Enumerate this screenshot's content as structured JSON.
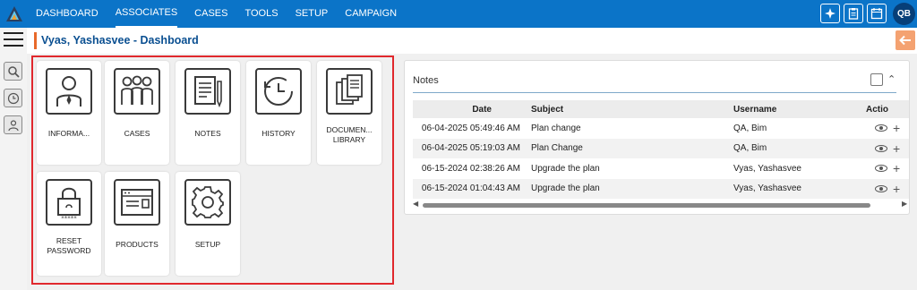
{
  "nav": {
    "items": [
      "DASHBOARD",
      "ASSOCIATES",
      "CASES",
      "TOOLS",
      "SETUP",
      "CAMPAIGN"
    ],
    "active": "ASSOCIATES"
  },
  "user": {
    "initials": "QB"
  },
  "page": {
    "title": "Vyas, Yashasvee - Dashboard"
  },
  "tiles": [
    {
      "label": "INFORMA...",
      "icon": "person-icon"
    },
    {
      "label": "CASES",
      "icon": "group-icon"
    },
    {
      "label": "NOTES",
      "icon": "notes-icon"
    },
    {
      "label": "HISTORY",
      "icon": "history-icon"
    },
    {
      "label": "DOCUMEN...\nLIBRARY",
      "icon": "documents-icon"
    },
    {
      "label": "RESET\nPASSWORD",
      "icon": "lock-icon"
    },
    {
      "label": "PRODUCTS",
      "icon": "products-icon"
    },
    {
      "label": "SETUP",
      "icon": "gear-icon"
    }
  ],
  "notes": {
    "title": "Notes",
    "columns": [
      "Date",
      "Subject",
      "Username",
      "Actio"
    ],
    "rows": [
      {
        "date": "06-04-2025 05:49:46 AM",
        "subject": "Plan change",
        "username": "QA, Bim"
      },
      {
        "date": "06-04-2025 05:19:03 AM",
        "subject": "Plan Change",
        "username": "QA, Bim"
      },
      {
        "date": "06-15-2024 02:38:26 AM",
        "subject": "Upgrade the plan",
        "username": "Vyas, Yashasvee"
      },
      {
        "date": "06-15-2024 01:04:43 AM",
        "subject": "Upgrade the plan",
        "username": "Vyas, Yashasvee"
      }
    ]
  },
  "colors": {
    "topbar": "#0b74c8",
    "title": "#0a4f91",
    "accent": "#e8692a",
    "highlight_frame": "#e0282d"
  }
}
